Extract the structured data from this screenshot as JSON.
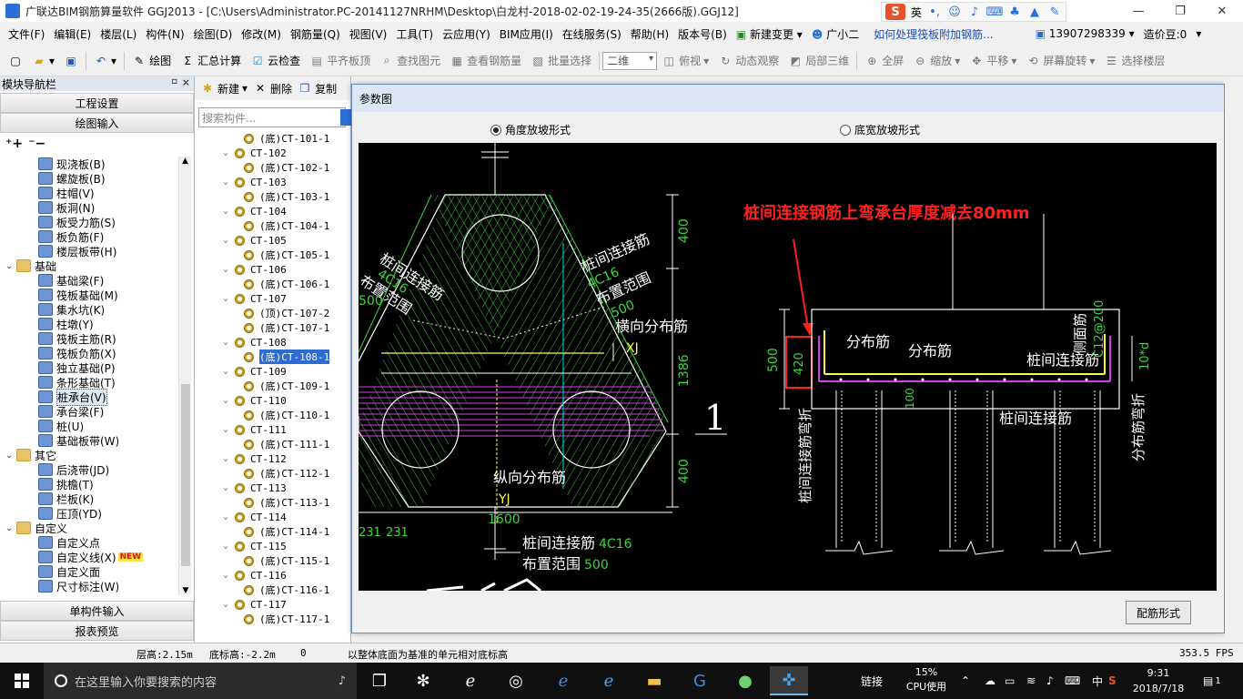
{
  "window": {
    "title": "广联达BIM钢筋算量软件 GGJ2013 - [C:\\Users\\Administrator.PC-20141127NRHM\\Desktop\\白龙村-2018-02-02-19-24-35(2666版).GGJ12]",
    "ime_label": "英",
    "min_icon": "minimize-icon",
    "restore_icon": "restore-icon",
    "close_icon": "close-icon"
  },
  "menu": {
    "items": [
      "文件(F)",
      "编辑(E)",
      "楼层(L)",
      "构件(N)",
      "绘图(D)",
      "修改(M)",
      "钢筋量(Q)",
      "视图(V)",
      "工具(T)",
      "云应用(Y)",
      "BIM应用(I)",
      "在线服务(S)",
      "帮助(H)",
      "版本号(B)"
    ],
    "new_change": "新建变更",
    "assistant": "广小二",
    "question_link": "如何处理筏板附加钢筋...",
    "phone": "13907298339",
    "price_beans": "造价豆:0"
  },
  "toolbar": {
    "draw": "绘图",
    "sum": "汇总计算",
    "cloud_check": "云检查",
    "flat_top": "平齐板顶",
    "find_element": "查找图元",
    "view_rebar": "查看钢筋量",
    "batch_select": "批量选择",
    "view_mode": "二维",
    "top_view": "俯视",
    "dynamic": "动态观察",
    "local_3d": "局部三维",
    "fullscreen": "全屏",
    "zoom": "缩放",
    "pan": "平移",
    "rotate": "屏幕旋转",
    "select_floor": "选择楼层"
  },
  "nav": {
    "header": "模块导航栏",
    "pin": "ᵖ",
    "close": "×",
    "project_settings": "工程设置",
    "drawing_input": "绘图输入",
    "tree": [
      {
        "kind": "leaf",
        "label": "现浇板(B)",
        "indent": 2
      },
      {
        "kind": "leaf",
        "label": "螺旋板(B)",
        "indent": 2
      },
      {
        "kind": "leaf",
        "label": "柱帽(V)",
        "indent": 2
      },
      {
        "kind": "leaf",
        "label": "板洞(N)",
        "indent": 2
      },
      {
        "kind": "leaf",
        "label": "板受力筋(S)",
        "indent": 2
      },
      {
        "kind": "leaf",
        "label": "板负筋(F)",
        "indent": 2
      },
      {
        "kind": "leaf",
        "label": "楼层板带(H)",
        "indent": 2
      },
      {
        "kind": "folder",
        "label": "基础",
        "indent": 0
      },
      {
        "kind": "leaf",
        "label": "基础梁(F)",
        "indent": 2
      },
      {
        "kind": "leaf",
        "label": "筏板基础(M)",
        "indent": 2
      },
      {
        "kind": "leaf",
        "label": "集水坑(K)",
        "indent": 2
      },
      {
        "kind": "leaf",
        "label": "柱墩(Y)",
        "indent": 2
      },
      {
        "kind": "leaf",
        "label": "筏板主筋(R)",
        "indent": 2
      },
      {
        "kind": "leaf",
        "label": "筏板负筋(X)",
        "indent": 2
      },
      {
        "kind": "leaf",
        "label": "独立基础(P)",
        "indent": 2
      },
      {
        "kind": "leaf",
        "label": "条形基础(T)",
        "indent": 2
      },
      {
        "kind": "leaf",
        "label": "桩承台(V)",
        "indent": 2,
        "selected": true
      },
      {
        "kind": "leaf",
        "label": "承台梁(F)",
        "indent": 2
      },
      {
        "kind": "leaf",
        "label": "桩(U)",
        "indent": 2
      },
      {
        "kind": "leaf",
        "label": "基础板带(W)",
        "indent": 2
      },
      {
        "kind": "folder",
        "label": "其它",
        "indent": 0
      },
      {
        "kind": "leaf",
        "label": "后浇带(JD)",
        "indent": 2
      },
      {
        "kind": "leaf",
        "label": "挑檐(T)",
        "indent": 2
      },
      {
        "kind": "leaf",
        "label": "栏板(K)",
        "indent": 2
      },
      {
        "kind": "leaf",
        "label": "压顶(YD)",
        "indent": 2
      },
      {
        "kind": "folder",
        "label": "自定义",
        "indent": 0
      },
      {
        "kind": "leaf",
        "label": "自定义点",
        "indent": 2
      },
      {
        "kind": "leaf",
        "label": "自定义线(X)",
        "indent": 2,
        "badge": "NEW"
      },
      {
        "kind": "leaf",
        "label": "自定义面",
        "indent": 2
      },
      {
        "kind": "leaf",
        "label": "尺寸标注(W)",
        "indent": 2
      }
    ],
    "single_input": "单构件输入",
    "report_preview": "报表预览"
  },
  "components": {
    "new": "新建",
    "delete": "删除",
    "copy": "复制",
    "search_placeholder": "搜索构件...",
    "rows": [
      {
        "label": "(底)CT-101-1",
        "child": true
      },
      {
        "label": "CT-102",
        "child": false
      },
      {
        "label": "(底)CT-102-1",
        "child": true
      },
      {
        "label": "CT-103",
        "child": false
      },
      {
        "label": "(底)CT-103-1",
        "child": true
      },
      {
        "label": "CT-104",
        "child": false
      },
      {
        "label": "(底)CT-104-1",
        "child": true
      },
      {
        "label": "CT-105",
        "child": false
      },
      {
        "label": "(底)CT-105-1",
        "child": true
      },
      {
        "label": "CT-106",
        "child": false
      },
      {
        "label": "(底)CT-106-1",
        "child": true
      },
      {
        "label": "CT-107",
        "child": false
      },
      {
        "label": "(顶)CT-107-2",
        "child": true
      },
      {
        "label": "(底)CT-107-1",
        "child": true
      },
      {
        "label": "CT-108",
        "child": false
      },
      {
        "label": "(底)CT-108-1",
        "child": true,
        "selected": true
      },
      {
        "label": "CT-109",
        "child": false
      },
      {
        "label": "(底)CT-109-1",
        "child": true
      },
      {
        "label": "CT-110",
        "child": false
      },
      {
        "label": "(底)CT-110-1",
        "child": true
      },
      {
        "label": "CT-111",
        "child": false
      },
      {
        "label": "(底)CT-111-1",
        "child": true
      },
      {
        "label": "CT-112",
        "child": false
      },
      {
        "label": "(底)CT-112-1",
        "child": true
      },
      {
        "label": "CT-113",
        "child": false
      },
      {
        "label": "(底)CT-113-1",
        "child": true
      },
      {
        "label": "CT-114",
        "child": false
      },
      {
        "label": "(底)CT-114-1",
        "child": true
      },
      {
        "label": "CT-115",
        "child": false
      },
      {
        "label": "(底)CT-115-1",
        "child": true
      },
      {
        "label": "CT-116",
        "child": false
      },
      {
        "label": "(底)CT-116-1",
        "child": true
      },
      {
        "label": "CT-117",
        "child": false
      },
      {
        "label": "(底)CT-117-1",
        "child": true
      }
    ]
  },
  "dialog": {
    "title": "参数图",
    "radio_angle": "角度放坡形式",
    "radio_width": "底宽放坡形式",
    "button_rebar": "配筋形式",
    "drawing": {
      "annotation_red": "桩间连接钢筋上弯承台厚度减去80mm",
      "pile_rebar_left": "桩间连接筋",
      "rebar_4c16_left": "4C16",
      "layout_range_left": "布置范围",
      "val_500_left": "500",
      "pile_rebar_right": "桩间连接筋",
      "rebar_4c16_right": "4C16",
      "layout_range_right": "布置范围",
      "val_500_right": "500",
      "horiz_dist": "横向分布筋",
      "xj": "XJ",
      "longi_dist": "纵向分布筋",
      "yj": "YJ",
      "dim_400_top": "400",
      "dim_1386": "1386",
      "dim_400_bot": "400",
      "dim_1600": "1600",
      "dim_231a": "231",
      "dim_231b": "231",
      "section_no": "1",
      "bottom_pile_rebar": "桩间连接筋",
      "bottom_4c16": "4C16",
      "bottom_range": "布置范围",
      "bottom_500": "500",
      "sec_dist1": "分布筋",
      "sec_dist2": "分布筋",
      "sec_pile_rebar": "桩间连接筋",
      "sec_side_rebar": "侧面筋",
      "sec_c12": "C12@200",
      "sec_10d": "10*d",
      "sec_500": "500",
      "sec_420": "420",
      "sec_100": "100",
      "sec_bend": "桩间连接筋弯折",
      "sec_dist_bend": "分布筋弯折",
      "sec_pile_rebar_bottom": "桩间连接筋"
    }
  },
  "status": {
    "floor_height": "层高:2.15m",
    "base_elevation": "底标高:-2.2m",
    "zero": "0",
    "hint": "以整体底面为基准的单元相对底标高",
    "fps": "353.5 FPS"
  },
  "taskbar": {
    "search_placeholder": "在这里输入你要搜索的内容",
    "link": "链接",
    "cpu_pct": "15%",
    "cpu_label": "CPU使用",
    "ime": "中",
    "time": "9:31",
    "date": "2018/7/18",
    "notif_count": "1"
  },
  "colors": {
    "green": "#3dd63d",
    "yellow": "#ffff40",
    "magenta": "#d040e0",
    "cyan": "#00e0e0",
    "white": "#ffffff",
    "red": "#ff2020",
    "selection": "#2d6cd3"
  }
}
